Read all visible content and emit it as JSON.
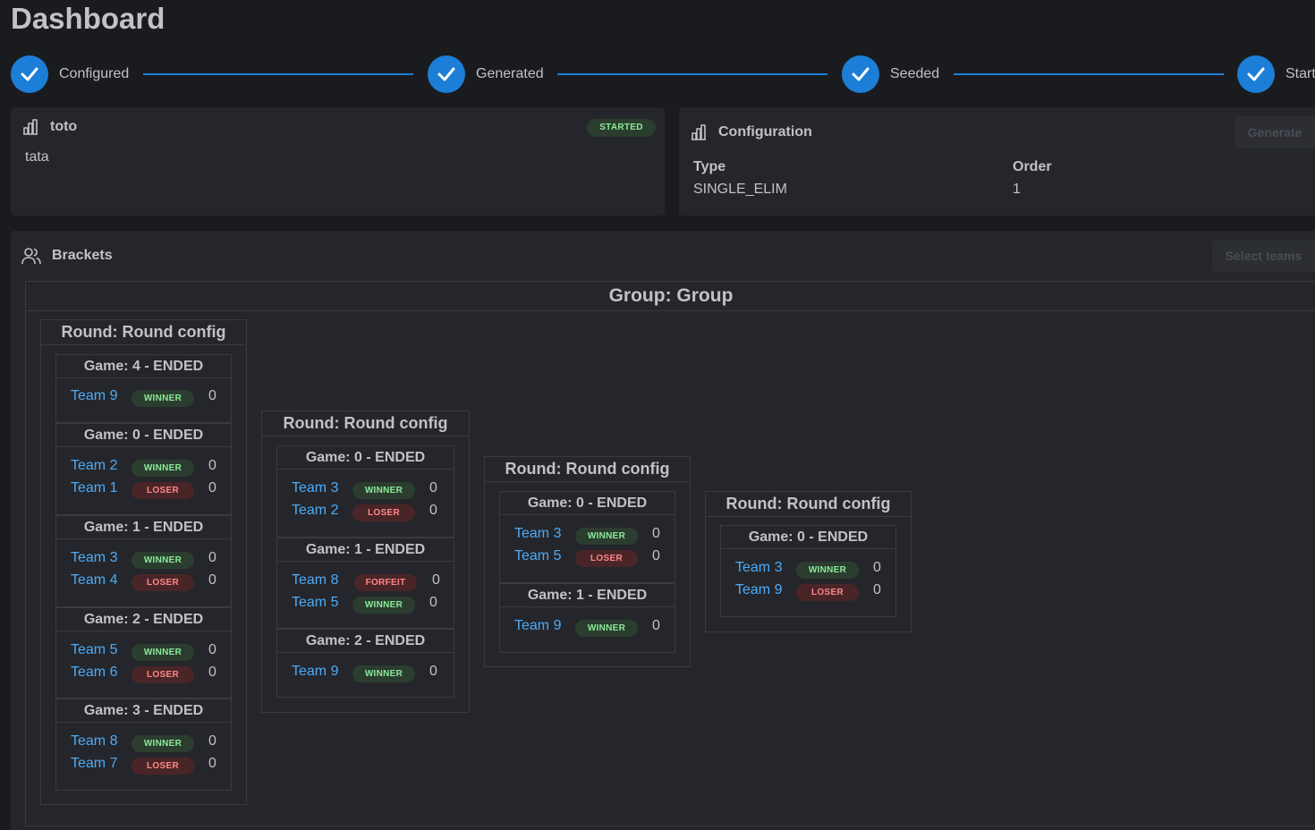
{
  "header": {
    "title": "Dashboard"
  },
  "stepper": {
    "steps": [
      {
        "label": "Configured"
      },
      {
        "label": "Generated"
      },
      {
        "label": "Seeded"
      },
      {
        "label": "Start"
      }
    ],
    "accent_color": "#1c7ed6"
  },
  "tournament_card": {
    "name": "toto",
    "description": "tata",
    "status": "STARTED",
    "icon": "bar-chart-icon"
  },
  "config_card": {
    "title": "Configuration",
    "button_label": "Generate",
    "icon": "bar-chart-icon",
    "fields": [
      {
        "label": "Type",
        "value": "SINGLE_ELIM"
      },
      {
        "label": "Order",
        "value": "1"
      }
    ]
  },
  "brackets_card": {
    "title": "Brackets",
    "button_label": "Select teams",
    "icon": "users-icon",
    "group_title": "Group: Group",
    "rounds": [
      {
        "title": "Round: Round config",
        "games": [
          {
            "title": "Game: 4 - ENDED",
            "matches": [
              {
                "team": "Team 9",
                "result": "WINNER",
                "score": "0"
              }
            ]
          },
          {
            "title": "Game: 0 - ENDED",
            "matches": [
              {
                "team": "Team 2",
                "result": "WINNER",
                "score": "0"
              },
              {
                "team": "Team 1",
                "result": "LOSER",
                "score": "0"
              }
            ]
          },
          {
            "title": "Game: 1 - ENDED",
            "matches": [
              {
                "team": "Team 3",
                "result": "WINNER",
                "score": "0"
              },
              {
                "team": "Team 4",
                "result": "LOSER",
                "score": "0"
              }
            ]
          },
          {
            "title": "Game: 2 - ENDED",
            "matches": [
              {
                "team": "Team 5",
                "result": "WINNER",
                "score": "0"
              },
              {
                "team": "Team 6",
                "result": "LOSER",
                "score": "0"
              }
            ]
          },
          {
            "title": "Game: 3 - ENDED",
            "matches": [
              {
                "team": "Team 8",
                "result": "WINNER",
                "score": "0"
              },
              {
                "team": "Team 7",
                "result": "LOSER",
                "score": "0"
              }
            ]
          }
        ]
      },
      {
        "title": "Round: Round config",
        "games": [
          {
            "title": "Game: 0 - ENDED",
            "matches": [
              {
                "team": "Team 3",
                "result": "WINNER",
                "score": "0"
              },
              {
                "team": "Team 2",
                "result": "LOSER",
                "score": "0"
              }
            ]
          },
          {
            "title": "Game: 1 - ENDED",
            "matches": [
              {
                "team": "Team 8",
                "result": "FORFEIT",
                "score": "0"
              },
              {
                "team": "Team 5",
                "result": "WINNER",
                "score": "0"
              }
            ]
          },
          {
            "title": "Game: 2 - ENDED",
            "matches": [
              {
                "team": "Team 9",
                "result": "WINNER",
                "score": "0"
              }
            ]
          }
        ]
      },
      {
        "title": "Round: Round config",
        "games": [
          {
            "title": "Game: 0 - ENDED",
            "matches": [
              {
                "team": "Team 3",
                "result": "WINNER",
                "score": "0"
              },
              {
                "team": "Team 5",
                "result": "LOSER",
                "score": "0"
              }
            ]
          },
          {
            "title": "Game: 1 - ENDED",
            "matches": [
              {
                "team": "Team 9",
                "result": "WINNER",
                "score": "0"
              }
            ]
          }
        ]
      },
      {
        "title": "Round: Round config",
        "games": [
          {
            "title": "Game: 0 - ENDED",
            "matches": [
              {
                "team": "Team 3",
                "result": "WINNER",
                "score": "0"
              },
              {
                "team": "Team 9",
                "result": "LOSER",
                "score": "0"
              }
            ]
          }
        ]
      }
    ]
  },
  "colors": {
    "background": "#1a1b1e",
    "card": "#25262b",
    "team_link": "#4dabf7",
    "winner_badge": "#2b3d2f",
    "loser_badge": "#4a2527"
  }
}
